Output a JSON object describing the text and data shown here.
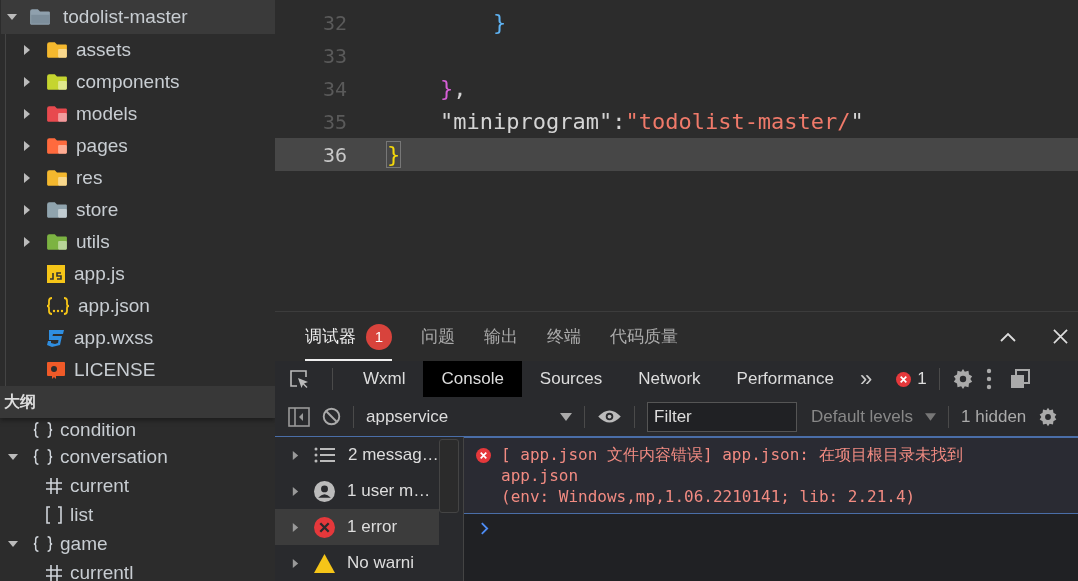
{
  "file_tree": {
    "root": {
      "name": "todolist-master",
      "expanded": true,
      "selected": true
    },
    "items": [
      {
        "name": "assets",
        "kind": "folder",
        "expanded": false,
        "color": "#f4b82e"
      },
      {
        "name": "components",
        "kind": "folder",
        "expanded": false,
        "color": "#c5d52f"
      },
      {
        "name": "models",
        "kind": "folder",
        "expanded": false,
        "color": "#e8494e"
      },
      {
        "name": "pages",
        "kind": "folder",
        "expanded": false,
        "color": "#ff6a3d"
      },
      {
        "name": "res",
        "kind": "folder",
        "expanded": false,
        "color": "#f4b82e"
      },
      {
        "name": "store",
        "kind": "folder",
        "expanded": false,
        "color": "#90a4ae"
      },
      {
        "name": "utils",
        "kind": "folder",
        "expanded": false,
        "color": "#7cb342"
      },
      {
        "name": "app.js",
        "kind": "js"
      },
      {
        "name": "app.json",
        "kind": "json"
      },
      {
        "name": "app.wxss",
        "kind": "css"
      },
      {
        "name": "LICENSE",
        "kind": "license"
      }
    ]
  },
  "outline": {
    "title": "大纲",
    "items": [
      {
        "name": "condition",
        "kind": "object"
      },
      {
        "name": "conversation",
        "kind": "object",
        "expanded": true,
        "children": [
          {
            "name": "current",
            "kind": "number"
          },
          {
            "name": "list",
            "kind": "array"
          }
        ]
      },
      {
        "name": "game",
        "kind": "object",
        "expanded": true,
        "children": [
          {
            "name": "currentl",
            "kind": "number"
          }
        ]
      }
    ]
  },
  "editor": {
    "lines": [
      {
        "number": "32",
        "current": false,
        "tokens": [
          {
            "text": "        }",
            "kind": "brace2"
          }
        ]
      },
      {
        "number": "33",
        "current": false
      },
      {
        "number": "34",
        "current": false,
        "tokens": [
          {
            "text": "    }",
            "kind": "brace1"
          },
          {
            "text": ",",
            "kind": "plain"
          }
        ]
      },
      {
        "number": "35",
        "current": false,
        "tokens": [
          {
            "text": "    \"miniprogram\"",
            "kind": "plain"
          },
          {
            "text": ":",
            "kind": "plain"
          },
          {
            "text": "\"todolist-master/",
            "kind": "string"
          },
          {
            "text": "\"",
            "kind": "plain"
          }
        ]
      },
      {
        "number": "36",
        "current": true,
        "tokens": [
          {
            "text": "}",
            "kind": "brace0"
          }
        ]
      }
    ]
  },
  "devtools": {
    "panel_tabs": [
      {
        "label": "调试器",
        "selected": true,
        "badge": "1"
      },
      {
        "label": "问题",
        "selected": false
      },
      {
        "label": "输出",
        "selected": false
      },
      {
        "label": "终端",
        "selected": false
      },
      {
        "label": "代码质量",
        "selected": false
      }
    ],
    "tool_tabs": [
      {
        "label": "Wxml",
        "selected": false
      },
      {
        "label": "Console",
        "selected": true
      },
      {
        "label": "Sources",
        "selected": false
      },
      {
        "label": "Network",
        "selected": false
      },
      {
        "label": "Performance",
        "selected": false
      }
    ],
    "overflow": "»",
    "error_count": "1",
    "context": "appservice",
    "filter": {
      "placeholder": "Filter"
    },
    "levels": "Default levels",
    "hidden": "1 hidden",
    "sidebar": [
      {
        "label": "2 messag…",
        "kind": "list",
        "selected": false
      },
      {
        "label": "1 user m…",
        "kind": "user",
        "selected": false
      },
      {
        "label": "1 error",
        "kind": "error",
        "selected": true
      },
      {
        "label": "No warni",
        "kind": "warning",
        "selected": false
      }
    ],
    "messages": [
      {
        "kind": "error",
        "lines": [
          "[ app.json 文件内容错误] app.json: 在项目根目录未找到",
          "app.json",
          "(env: Windows,mp,1.06.2210141; lib: 2.21.4)"
        ]
      }
    ]
  }
}
